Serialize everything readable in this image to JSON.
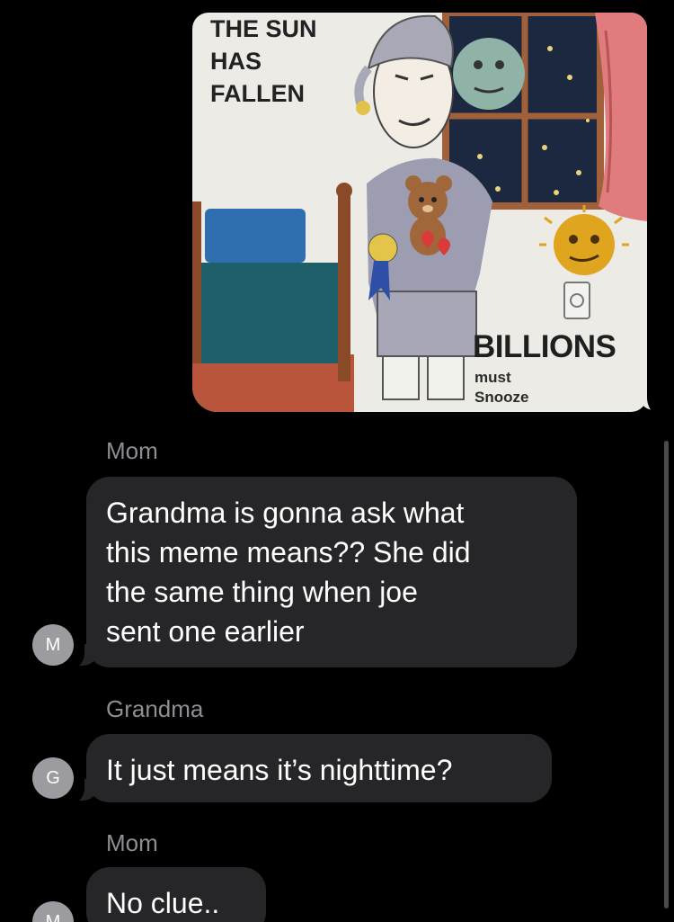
{
  "meme": {
    "top_text": [
      "THE SUN",
      "HAS",
      "FALLEN"
    ],
    "billions": "BILLIONS",
    "must": "must",
    "snooze": "Snooze"
  },
  "messages": [
    {
      "sender": "Mom",
      "avatar_initial": "M",
      "lines": [
        "Grandma is gonna ask what",
        "this meme means?? She did",
        "the same thing when joe",
        "sent one earlier"
      ]
    },
    {
      "sender": "Grandma",
      "avatar_initial": "G",
      "lines": [
        "It just means it’s nighttime?"
      ]
    },
    {
      "sender": "Mom",
      "avatar_initial": "M",
      "lines": [
        "No clue.."
      ]
    }
  ],
  "colors": {
    "background": "#000000",
    "incoming_bubble": "#262628",
    "sender_label": "#8e8e93",
    "avatar": "#9b9ba0"
  }
}
